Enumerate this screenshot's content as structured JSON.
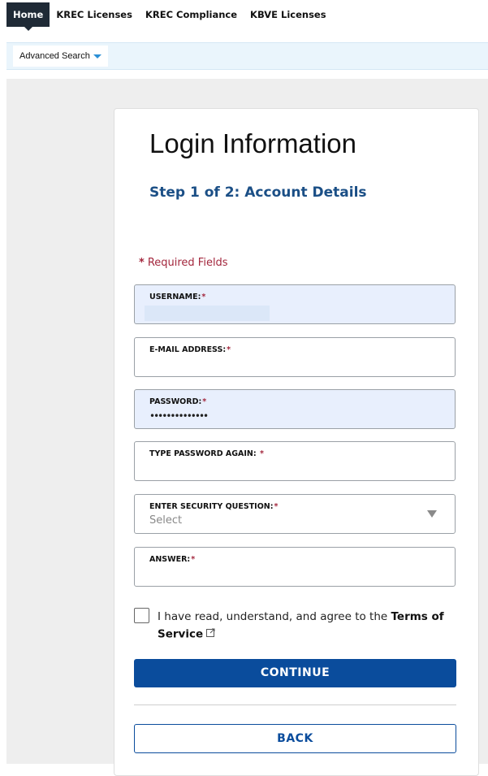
{
  "nav": {
    "tabs": [
      {
        "label": "Home"
      },
      {
        "label": "KREC Licenses"
      },
      {
        "label": "KREC Compliance"
      },
      {
        "label": "KBVE Licenses"
      }
    ],
    "active_tab": "Home"
  },
  "subnav": {
    "advanced_search": "Advanced Search"
  },
  "form": {
    "title": "Login Information",
    "step": "Step 1 of 2: Account Details",
    "required_note": "Required Fields",
    "required_star": "*",
    "fields": {
      "username": {
        "label": "USERNAME:",
        "value": ""
      },
      "email": {
        "label": "E-MAIL ADDRESS:",
        "value": ""
      },
      "password": {
        "label": "PASSWORD:",
        "value": "••••••••••••••"
      },
      "password_again": {
        "label": "TYPE PASSWORD AGAIN: ",
        "value": ""
      },
      "security_question": {
        "label": "ENTER SECURITY QUESTION:",
        "value": "Select"
      },
      "answer": {
        "label": "ANSWER:",
        "value": ""
      }
    },
    "tos": {
      "text": "I have read, understand, and agree to the ",
      "link": "Terms of Service",
      "checked": false
    },
    "continue_label": "CONTINUE",
    "back_label": "BACK"
  },
  "colors": {
    "primary": "#0a4c9c",
    "required": "#a3273d",
    "heading": "#1b4f86",
    "nav_active": "#1f2a36"
  }
}
